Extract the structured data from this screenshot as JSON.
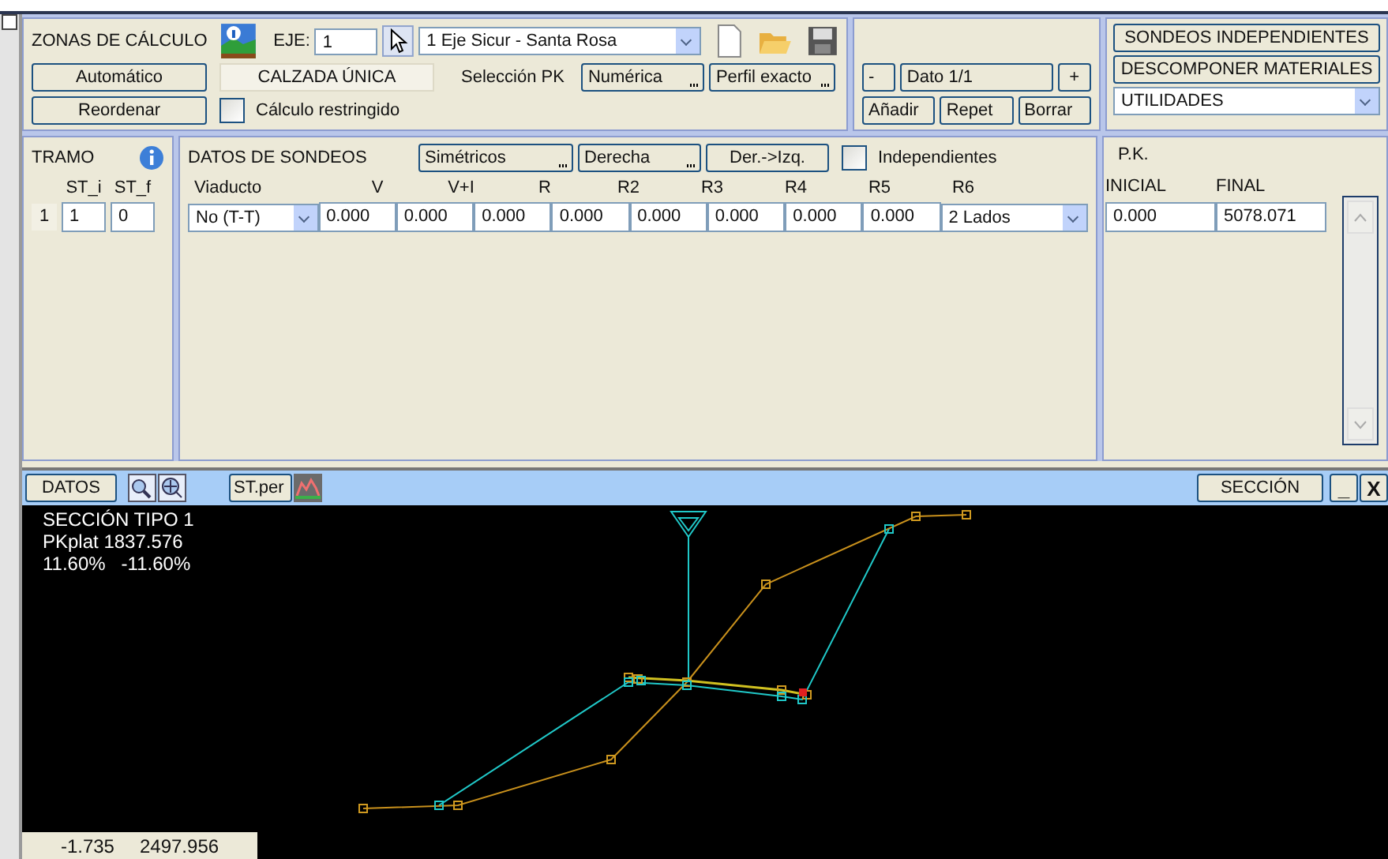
{
  "zonas": {
    "title": "ZONAS DE CÁLCULO",
    "eje_label": "EJE:",
    "eje_value": "1",
    "eje_select": "1 Eje Sicur - Santa Rosa",
    "buttons": [
      {
        "label": "Automático"
      },
      {
        "label": "Reordenar"
      }
    ],
    "calzada": "CALZADA ÚNICA",
    "seleccion_label": "Selección PK",
    "seleccion_buttons": [
      {
        "label": "Numérica"
      },
      {
        "label": "Perfil exacto"
      }
    ],
    "restringido": {
      "label": "Cálculo restringido",
      "checked": false
    }
  },
  "dato": {
    "minus": "-",
    "value": "Dato 1/1",
    "plus": "+",
    "buttons": [
      {
        "label": "Añadir"
      },
      {
        "label": "Repet"
      },
      {
        "label": "Borrar"
      }
    ]
  },
  "acciones": {
    "buttons": [
      {
        "label": "SONDEOS INDEPENDIENTES"
      },
      {
        "label": "DESCOMPONER MATERIALES"
      }
    ],
    "select": "UTILIDADES"
  },
  "tramo": {
    "title": "TRAMO",
    "columns": [
      "ST_i",
      "ST_f"
    ],
    "row": {
      "index": "1",
      "st_i": "1",
      "st_f": "0"
    }
  },
  "sondeos": {
    "title": "DATOS DE SONDEOS",
    "buttons": [
      {
        "label": "Simétricos",
        "more": true
      },
      {
        "label": "Derecha",
        "more": true
      },
      {
        "label": "Der.->Izq.",
        "more": false
      }
    ],
    "independientes": {
      "label": "Independientes",
      "checked": false
    },
    "columns": [
      "Viaducto",
      "V",
      "V+I",
      "R",
      "R2",
      "R3",
      "R4",
      "R5",
      "R6"
    ],
    "row": {
      "viaducto": "No (T-T)",
      "values": [
        "0.000",
        "0.000",
        "0.000",
        "0.000",
        "0.000",
        "0.000",
        "0.000",
        "0.000"
      ],
      "lados": "2 Lados"
    }
  },
  "pk": {
    "title": "P.K.",
    "columns": [
      "INICIAL",
      "FINAL"
    ],
    "values": [
      "0.000",
      "5078.071"
    ]
  },
  "viewer": {
    "datos": "DATOS",
    "st_per": "ST.per",
    "seccion": "SECCIÓN",
    "minimize": "_",
    "close": "X",
    "info": [
      "SECCIÓN TIPO 1",
      "PKplat 1837.576",
      "11.60%   -11.60%"
    ],
    "status": [
      "-1.735",
      "2497.956"
    ]
  }
}
